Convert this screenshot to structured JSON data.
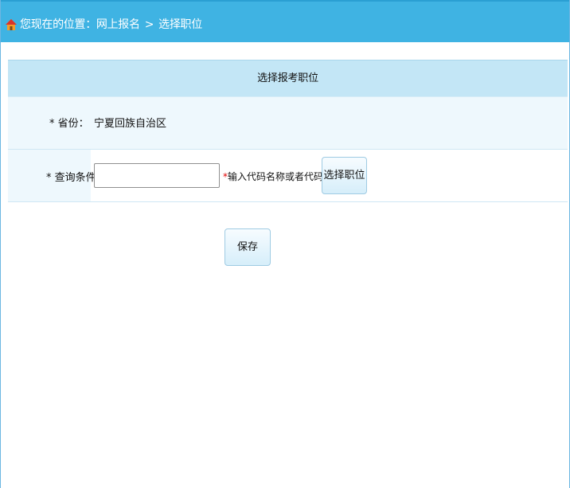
{
  "breadcrumb": {
    "home_icon": "home-icon",
    "prefix": "您现在的位置：",
    "parent": "网上报名",
    "separator": ">",
    "current": "选择职位"
  },
  "form": {
    "title": "选择报考职位",
    "province_label": "* 省份：",
    "province_value": "宁夏回族自治区",
    "query_label": "* 查询条件：",
    "query_value": "",
    "query_placeholder": "",
    "hint_star": "*",
    "hint_text": "输入代码名称或者代码",
    "select_button": "选择职位"
  },
  "actions": {
    "save_button": "保存"
  },
  "colors": {
    "topbar": "#3fb3e3",
    "title_row": "#c3e6f6",
    "label_bg": "#eef8fd",
    "required_star": "#e00000"
  }
}
